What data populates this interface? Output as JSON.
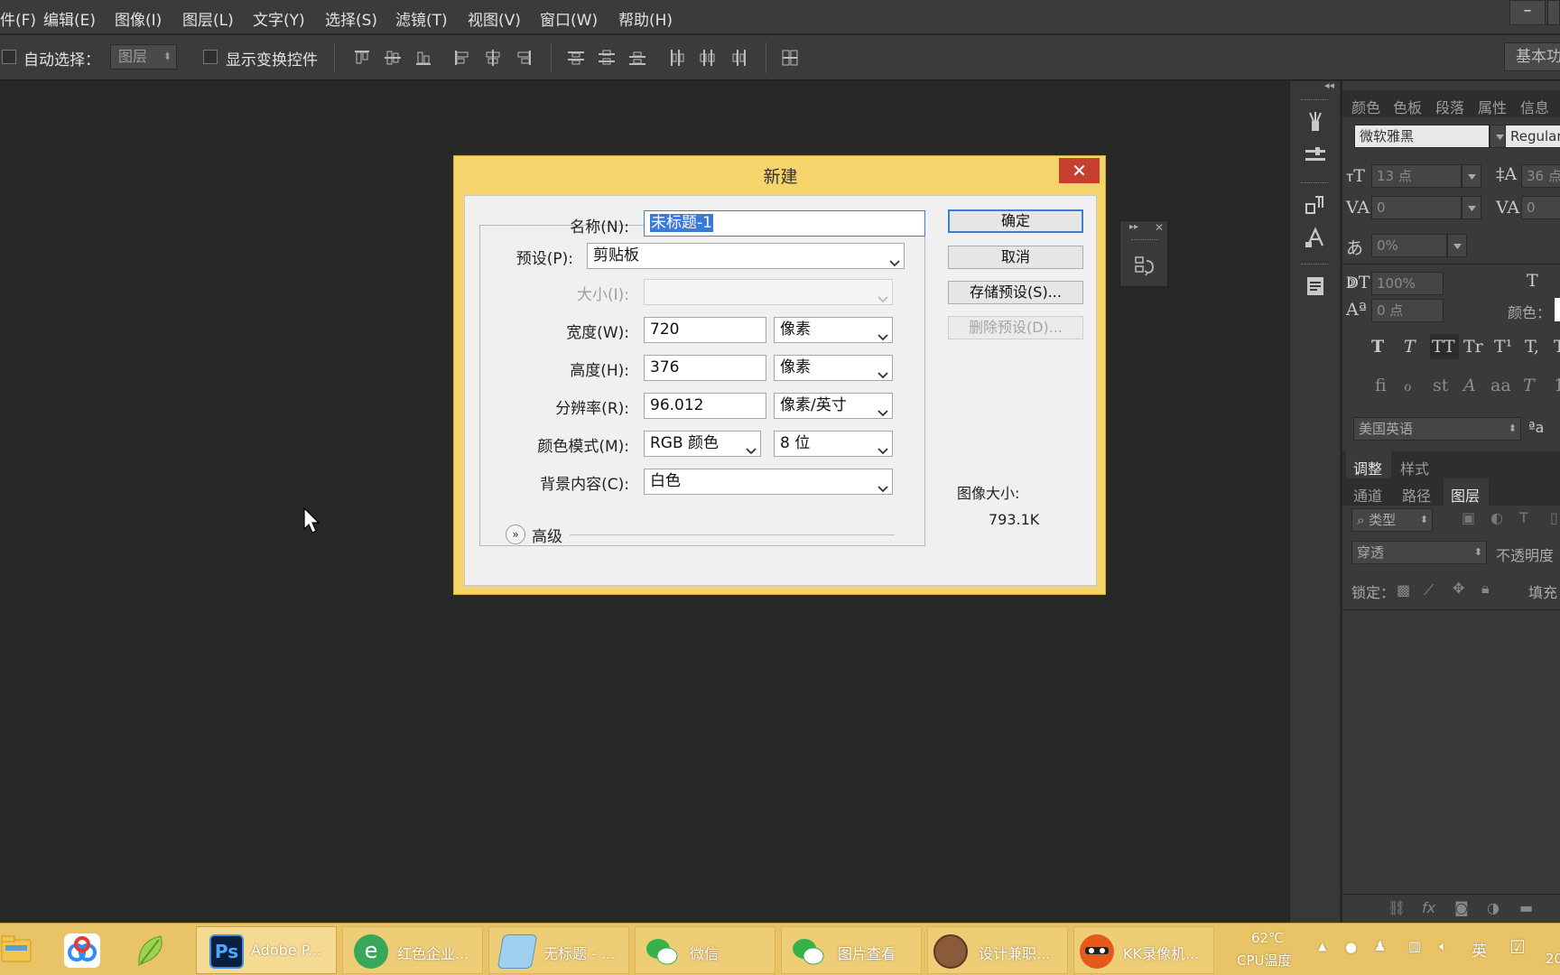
{
  "menubar": {
    "items": [
      "件(F)",
      "编辑(E)",
      "图像(I)",
      "图层(L)",
      "文字(Y)",
      "选择(S)",
      "滤镜(T)",
      "视图(V)",
      "窗口(W)",
      "帮助(H)"
    ],
    "minimize": "–"
  },
  "options": {
    "auto_select_label": "自动选择：",
    "auto_select_value": "图层",
    "show_transform_label": "显示变换控件",
    "workspace_label": "基本功"
  },
  "dialog": {
    "title": "新建",
    "close_glyph": "✕",
    "name_label": "名称(N):",
    "name_value": "未标题-1",
    "preset_label": "预设(P):",
    "preset_value": "剪贴板",
    "size_label": "大小(I):",
    "size_value": "",
    "width_label": "宽度(W):",
    "width_value": "720",
    "width_unit": "像素",
    "height_label": "高度(H):",
    "height_value": "376",
    "height_unit": "像素",
    "resolution_label": "分辨率(R):",
    "resolution_value": "96.012",
    "resolution_unit": "像素/英寸",
    "color_mode_label": "颜色模式(M):",
    "color_mode_value": "RGB 颜色",
    "bit_depth_value": "8 位",
    "background_label": "背景内容(C):",
    "background_value": "白色",
    "advanced_label": "高级",
    "ok_button": "确定",
    "cancel_button": "取消",
    "save_preset_button": "存储预设(S)...",
    "delete_preset_button": "删除预设(D)...",
    "image_size_label": "图像大小:",
    "image_size_value": "793.1K"
  },
  "right_panel": {
    "top_tabs": [
      "颜色",
      "色板",
      "段落",
      "属性",
      "信息"
    ],
    "font_family": "微软雅黑",
    "font_style": "Regular",
    "font_size": "13 点",
    "leading": "36 点",
    "kerning": "0",
    "tracking": "0",
    "scale": "0%",
    "vertical_scale": "100%",
    "baseline": "0 点",
    "color_label": "颜色：",
    "text_style_glyphs": [
      "T",
      "T",
      "TT",
      "Tr",
      "T¹",
      "T,",
      "T"
    ],
    "opentype_glyphs": [
      "fi",
      "ℴ",
      "st",
      "A",
      "aa",
      "T",
      "1"
    ],
    "language": "美国英语",
    "aa_glyph": "ªa",
    "adjust_tabs": [
      "调整",
      "样式"
    ],
    "layer_tabs": [
      "通道",
      "路径",
      "图层"
    ],
    "layer_filter": "类型",
    "blend_mode": "穿透",
    "opacity_label": "不透明度",
    "lock_label": "锁定：",
    "fill_label": "填充"
  },
  "taskbar": {
    "items": [
      {
        "label": "Adobe P..."
      },
      {
        "label": "红色企业..."
      },
      {
        "label": "无标题 - ..."
      },
      {
        "label": "微信"
      },
      {
        "label": "图片查看"
      },
      {
        "label": "设计兼职..."
      },
      {
        "label": "KK录像机..."
      }
    ],
    "ps_icon_text": "Ps",
    "temp": "62℃",
    "temp_label": "CPU温度",
    "ime": "英",
    "clock_partial": "20"
  },
  "colors": {
    "app_bg": "#282828",
    "dialog_frame": "#f6d46c",
    "close_red": "#c7402f",
    "selection_blue": "#3b79d6",
    "taskbar": "#e9c466"
  }
}
